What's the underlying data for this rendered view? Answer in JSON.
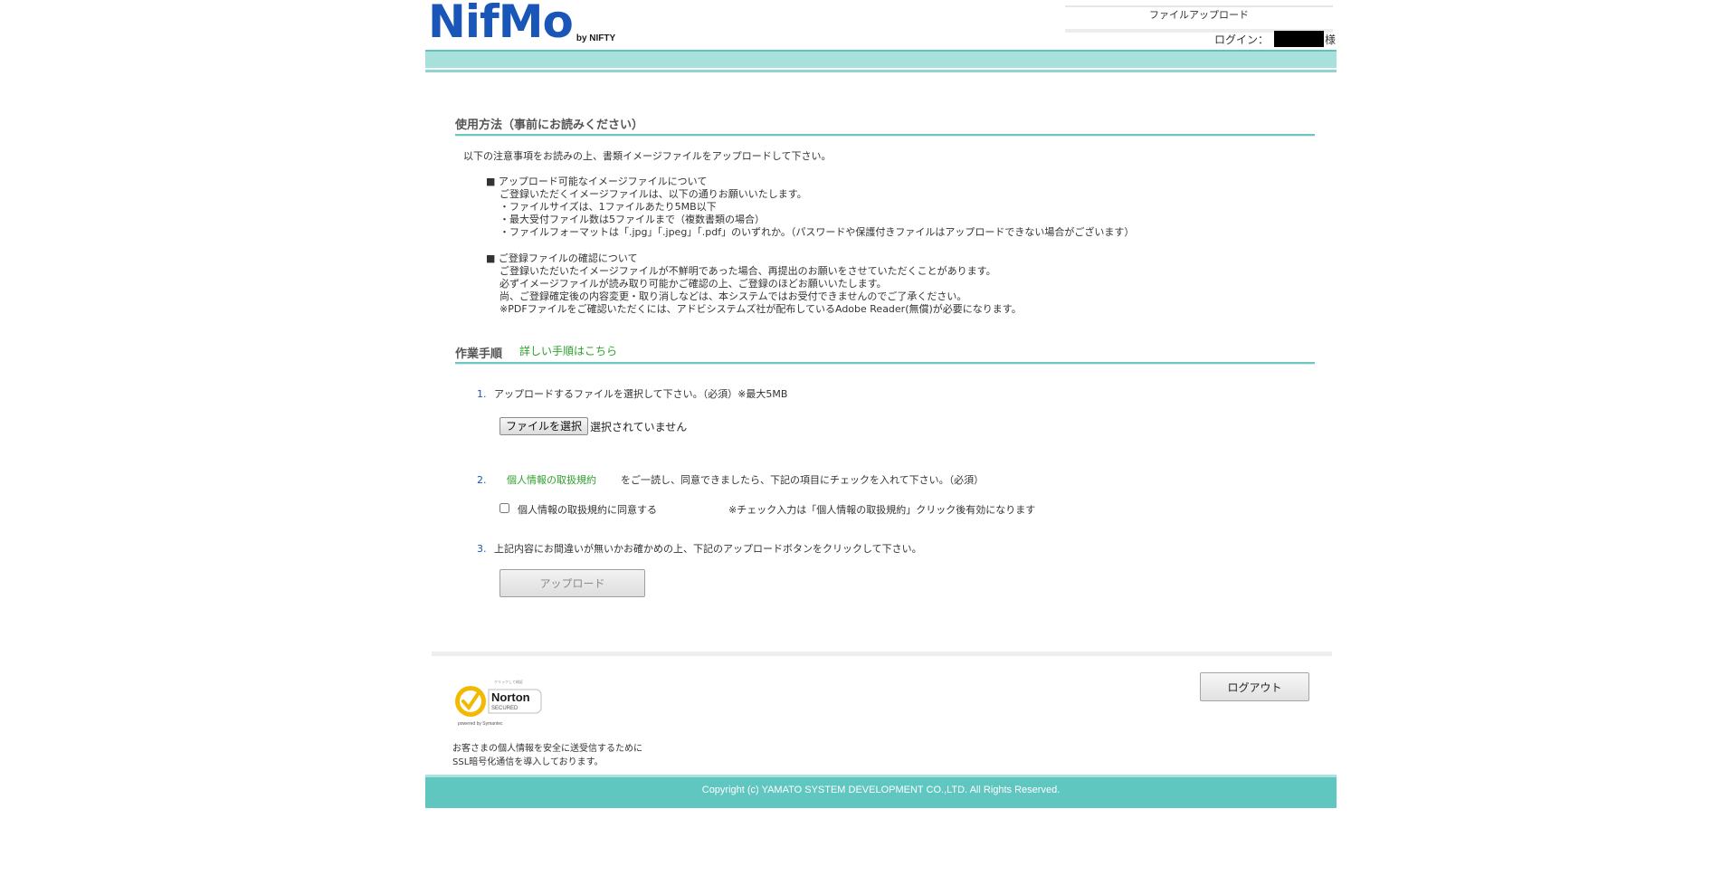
{
  "header": {
    "logo_main": "NifMo",
    "logo_by": "by NIFTY",
    "page_label": "ファイルアップロード",
    "login_label": "ログイン：",
    "login_suffix": "様"
  },
  "usage": {
    "title": "使用方法（事前にお読みください）",
    "intro": "以下の注意事項をお読みの上、書類イメージファイルをアップロードして下さい。",
    "block1": {
      "head": "■ アップロード可能なイメージファイルについて",
      "lines": [
        "ご登録いただくイメージファイルは、以下の通りお願いいたします。",
        "・ファイルサイズは、1ファイルあたり5MB以下",
        "・最大受付ファイル数は5ファイルまで（複数書類の場合）",
        "・ファイルフォーマットは「.jpg」「.jpeg」「.pdf」のいずれか。（パスワードや保護付きファイルはアップロードできない場合がございます）"
      ]
    },
    "block2": {
      "head": "■ ご登録ファイルの確認について",
      "lines": [
        "ご登録いただいたイメージファイルが不鮮明であった場合、再提出のお願いをさせていただくことがあります。",
        "必ずイメージファイルが読み取り可能かご確認の上、ご登録のほどお願いいたします。",
        "尚、ご登録確定後の内容変更・取り消しなどは、本システムではお受付できませんのでご了承ください。",
        "※PDFファイルをご確認いただくには、アドビシステムズ社が配布しているAdobe Reader(無償)が必要になります。"
      ]
    }
  },
  "procedure": {
    "title": "作業手順",
    "detail_link": "詳しい手順はこちら",
    "step1": {
      "num": "1.",
      "text": "アップロードするファイルを選択して下さい。（必須）※最大5MB",
      "file_button": "ファイルを選択",
      "file_status": "選択されていません"
    },
    "step2": {
      "num": "2.",
      "policy_link": "個人情報の取扱規約",
      "text": "をご一読し、同意できましたら、下記の項目にチェックを入れて下さい。（必須）",
      "checkbox_label": "個人情報の取扱規約に同意する",
      "note": "※チェック入力は「個人情報の取扱規約」クリック後有効になります",
      "checked": false
    },
    "step3": {
      "num": "3.",
      "text": "上記内容にお間違いが無いかお確かめの上、下記のアップロードボタンをクリックして下さい。",
      "upload_button": "アップロード"
    }
  },
  "footer": {
    "norton": {
      "top_small": "クリックして検証",
      "brand": "Norton",
      "secured": "SECURED",
      "powered": "powered by Symantec"
    },
    "logout_button": "ログアウト",
    "ssl_line1": "お客さまの個人情報を安全に送受信するために",
    "ssl_line2": "SSL暗号化通信を導入しております。",
    "copyright": "Copyright (c) YAMATO SYSTEM DEVELOPMENT CO.,LTD. All Rights Reserved."
  },
  "colors": {
    "brand_blue": "#1a56b8",
    "teal": "#5fc6c0",
    "teal_light": "#a8e0dc",
    "link_green": "#2ca02c"
  }
}
